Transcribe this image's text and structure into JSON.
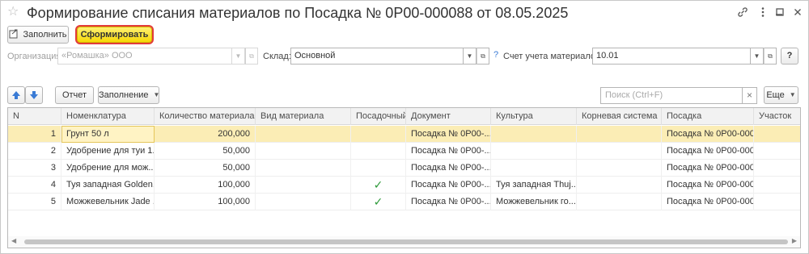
{
  "window": {
    "title": "Формирование списания материалов по Посадка № 0P00-000088 от 08.05.2025",
    "icons": [
      "star-icon",
      "link-icon",
      "more-icon",
      "minimize-icon",
      "maximize-icon",
      "close-icon"
    ]
  },
  "toolbar": {
    "fill_label": "Заполнить",
    "generate_label": "Сформировать"
  },
  "form": {
    "org_label": "Организация:",
    "org_value": "«Ромашка» ООО",
    "warehouse_label": "Склад:",
    "warehouse_value": "Основной",
    "help_mark": "?",
    "account_label": "Счет учета материалов:",
    "account_value": "10.01",
    "help_button": "?"
  },
  "table_toolbar": {
    "report_label": "Отчет",
    "filling_label": "Заполнение",
    "search_placeholder": "Поиск (Ctrl+F)",
    "search_clear": "×",
    "more_label": "Еще"
  },
  "table": {
    "columns": [
      "N",
      "Номенклатура",
      "Количество материала",
      "Вид материала",
      "Посадочный",
      "Документ",
      "Культура",
      "Корневая система",
      "Посадка",
      "Участок"
    ],
    "rows": [
      {
        "n": "1",
        "nomenclature": "Грунт 50 л",
        "qty": "200,000",
        "kind": "",
        "landing": false,
        "document": "Посадка № 0P00-...",
        "culture": "",
        "root": "",
        "posadka": "Посадка № 0P00-000...",
        "plot": ""
      },
      {
        "n": "2",
        "nomenclature": "Удобрение для туи 1...",
        "qty": "50,000",
        "kind": "",
        "landing": false,
        "document": "Посадка № 0P00-...",
        "culture": "",
        "root": "",
        "posadka": "Посадка № 0P00-000...",
        "plot": ""
      },
      {
        "n": "3",
        "nomenclature": "Удобрение для мож...",
        "qty": "50,000",
        "kind": "",
        "landing": false,
        "document": "Посадка № 0P00-...",
        "culture": "",
        "root": "",
        "posadka": "Посадка № 0P00-000...",
        "plot": ""
      },
      {
        "n": "4",
        "nomenclature": "Туя западная Golden...",
        "qty": "100,000",
        "kind": "",
        "landing": true,
        "document": "Посадка № 0P00-...",
        "culture": "Туя западная Thuj...",
        "root": "",
        "posadka": "Посадка № 0P00-000...",
        "plot": ""
      },
      {
        "n": "5",
        "nomenclature": "Можжевельник Jade ...",
        "qty": "100,000",
        "kind": "",
        "landing": true,
        "document": "Посадка № 0P00-...",
        "culture": "Можжевельник го...",
        "root": "",
        "posadka": "Посадка № 0P00-000...",
        "plot": ""
      }
    ],
    "selected_row": 1,
    "check_glyph": "✓"
  },
  "colors": {
    "selected_row": "#fbedb5",
    "primary_button": "#f6d700",
    "primary_button_border": "#e23b3b",
    "check": "#2e9a3a",
    "arrow_buttons": "#3a7bd5"
  }
}
